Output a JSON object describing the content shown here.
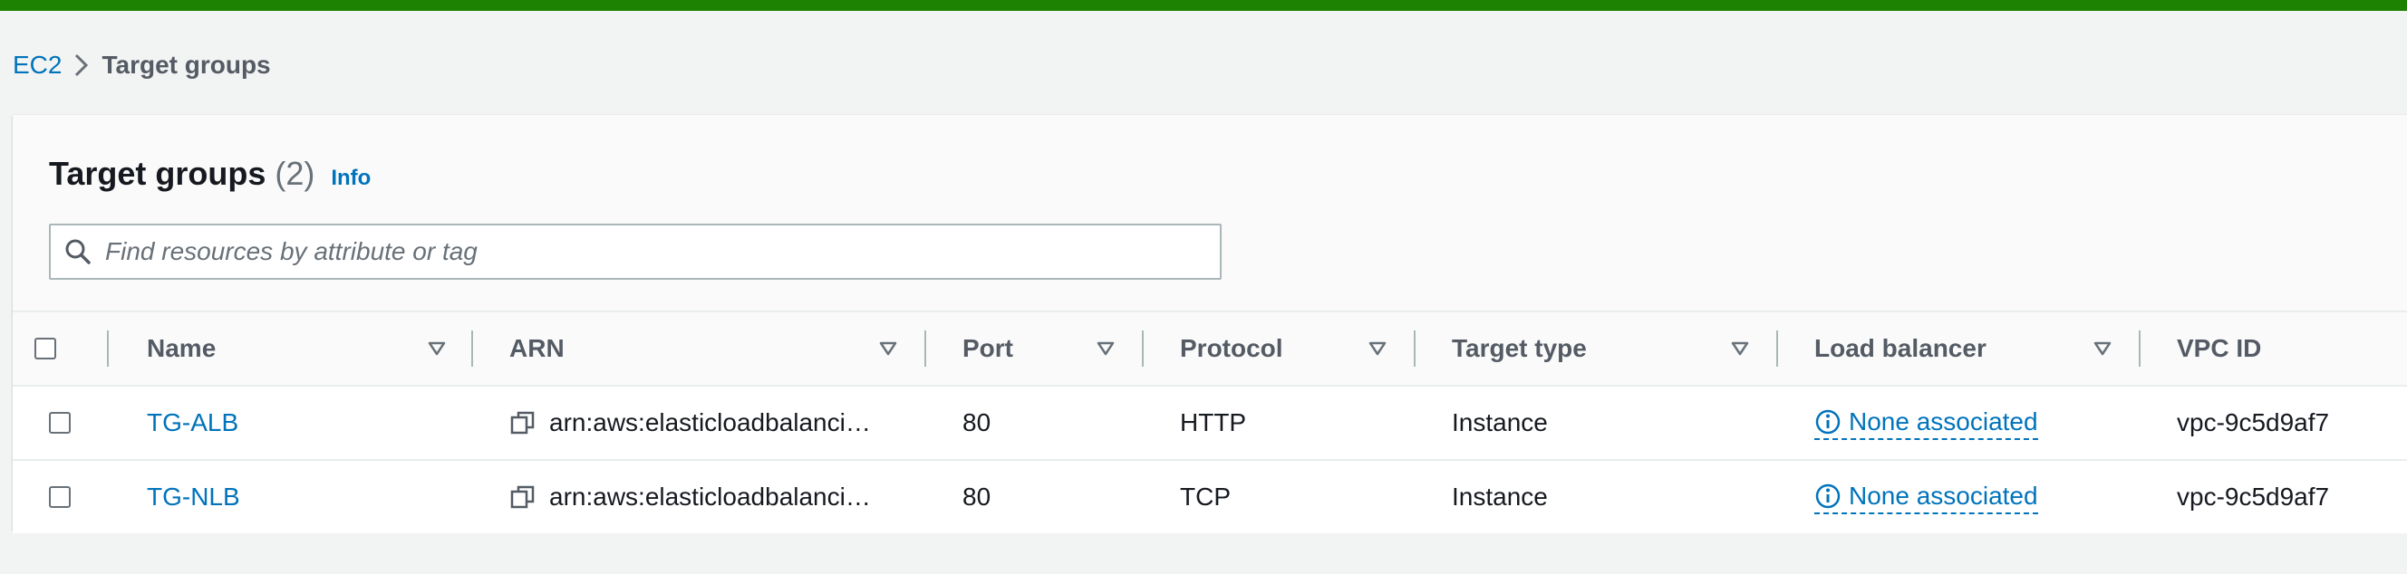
{
  "breadcrumb": {
    "root": "EC2",
    "current": "Target groups"
  },
  "header": {
    "title": "Target groups",
    "count": "(2)",
    "info": "Info"
  },
  "search": {
    "placeholder": "Find resources by attribute or tag",
    "value": ""
  },
  "table": {
    "columns": [
      "Name",
      "ARN",
      "Port",
      "Protocol",
      "Target type",
      "Load balancer",
      "VPC ID"
    ],
    "rows": [
      {
        "name": "TG-ALB",
        "arn": "arn:aws:elasticloadbalanci…",
        "port": "80",
        "protocol": "HTTP",
        "target_type": "Instance",
        "load_balancer": "None associated",
        "vpc_id": "vpc-9c5d9af7"
      },
      {
        "name": "TG-NLB",
        "arn": "arn:aws:elasticloadbalanci…",
        "port": "80",
        "protocol": "TCP",
        "target_type": "Instance",
        "load_balancer": "None associated",
        "vpc_id": "vpc-9c5d9af7"
      }
    ]
  },
  "icons": {
    "breadcrumb_separator": "chevron-right-icon",
    "search": "search-icon",
    "sort": "sort-down-icon",
    "copy": "copy-icon",
    "info": "info-circle-icon"
  },
  "colors": {
    "top_bar": "#1d8102",
    "link": "#0073bb",
    "background": "#f2f3f3",
    "text": "#16191f",
    "header_text": "#545b64"
  }
}
